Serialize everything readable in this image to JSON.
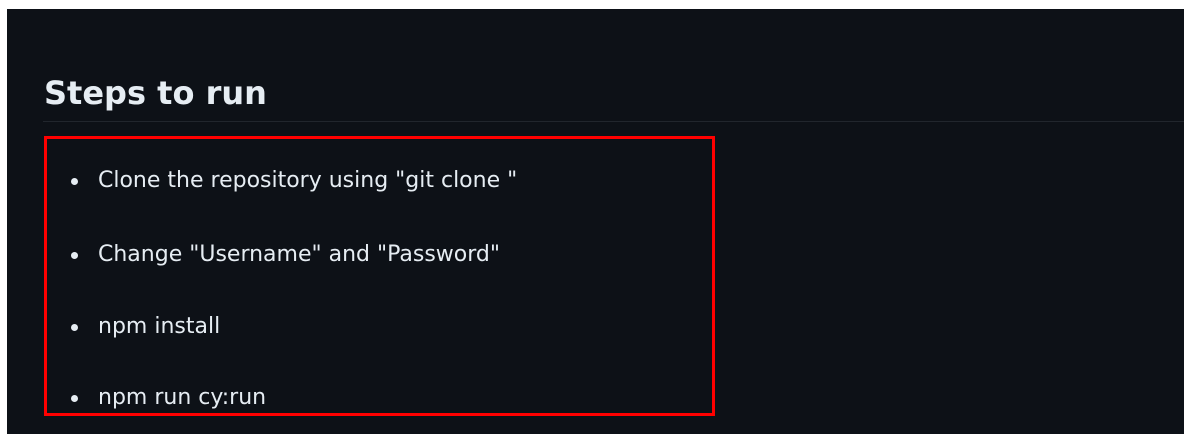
{
  "section": {
    "title": "Steps to run"
  },
  "steps": [
    {
      "text": "Clone the repository using \"git clone \""
    },
    {
      "text": "Change \"Username\" and \"Password\""
    },
    {
      "text": "npm install"
    },
    {
      "text": "npm run cy:run"
    }
  ],
  "colors": {
    "background": "#0d1117",
    "text": "#e6edf3",
    "divider": "#21262d",
    "highlight_border": "#ff0000"
  }
}
